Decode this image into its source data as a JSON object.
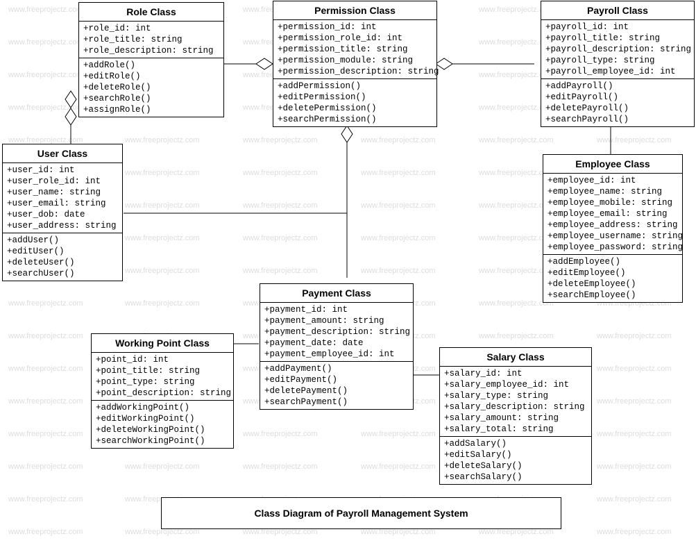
{
  "watermark": "www.freeprojectz.com",
  "diagram_title": "Class Diagram of Payroll Management System",
  "classes": {
    "role": {
      "title": "Role Class",
      "attrs": [
        "+role_id: int",
        "+role_title: string",
        "+role_description: string"
      ],
      "methods": [
        "+addRole()",
        "+editRole()",
        "+deleteRole()",
        "+searchRole()",
        "+assignRole()"
      ]
    },
    "permission": {
      "title": "Permission Class",
      "attrs": [
        "+permission_id: int",
        "+permission_role_id: int",
        "+permission_title: string",
        "+permission_module: string",
        "+permission_description: string"
      ],
      "methods": [
        "+addPermission()",
        "+editPermission()",
        "+deletePermission()",
        "+searchPermission()"
      ]
    },
    "payroll": {
      "title": "Payroll Class",
      "attrs": [
        "+payroll_id: int",
        "+payroll_title: string",
        "+payroll_description: string",
        "+payroll_type: string",
        "+payroll_employee_id: int"
      ],
      "methods": [
        "+addPayroll()",
        "+editPayroll()",
        "+deletePayroll()",
        "+searchPayroll()"
      ]
    },
    "user": {
      "title": "User Class",
      "attrs": [
        "+user_id: int",
        "+user_role_id: int",
        "+user_name: string",
        "+user_email: string",
        "+user_dob: date",
        "+user_address: string"
      ],
      "methods": [
        "+addUser()",
        "+editUser()",
        "+deleteUser()",
        "+searchUser()"
      ]
    },
    "employee": {
      "title": "Employee Class",
      "attrs": [
        "+employee_id: int",
        "+employee_name: string",
        "+employee_mobile: string",
        "+employee_email: string",
        "+employee_address: string",
        "+employee_username: string",
        "+employee_password: string"
      ],
      "methods": [
        "+addEmployee()",
        "+editEmployee()",
        "+deleteEmployee()",
        "+searchEmployee()"
      ]
    },
    "workingpoint": {
      "title": "Working Point Class",
      "attrs": [
        "+point_id: int",
        "+point_title: string",
        "+point_type: string",
        "+point_description: string"
      ],
      "methods": [
        "+addWorkingPoint()",
        "+editWorkingPoint()",
        "+deleteWorkingPoint()",
        "+searchWorkingPoint()"
      ]
    },
    "payment": {
      "title": "Payment Class",
      "attrs": [
        "+payment_id: int",
        "+payment_amount: string",
        "+payment_description: string",
        "+payment_date: date",
        "+payment_employee_id: int"
      ],
      "methods": [
        "+addPayment()",
        "+editPayment()",
        "+deletePayment()",
        "+searchPayment()"
      ]
    },
    "salary": {
      "title": "Salary Class",
      "attrs": [
        "+salary_id: int",
        "+salary_employee_id: int",
        "+salary_type: string",
        "+salary_description: string",
        "+salary_amount: string",
        "+salary_total: string"
      ],
      "methods": [
        "+addSalary()",
        "+editSalary()",
        "+deleteSalary()",
        "+searchSalary()"
      ]
    }
  }
}
